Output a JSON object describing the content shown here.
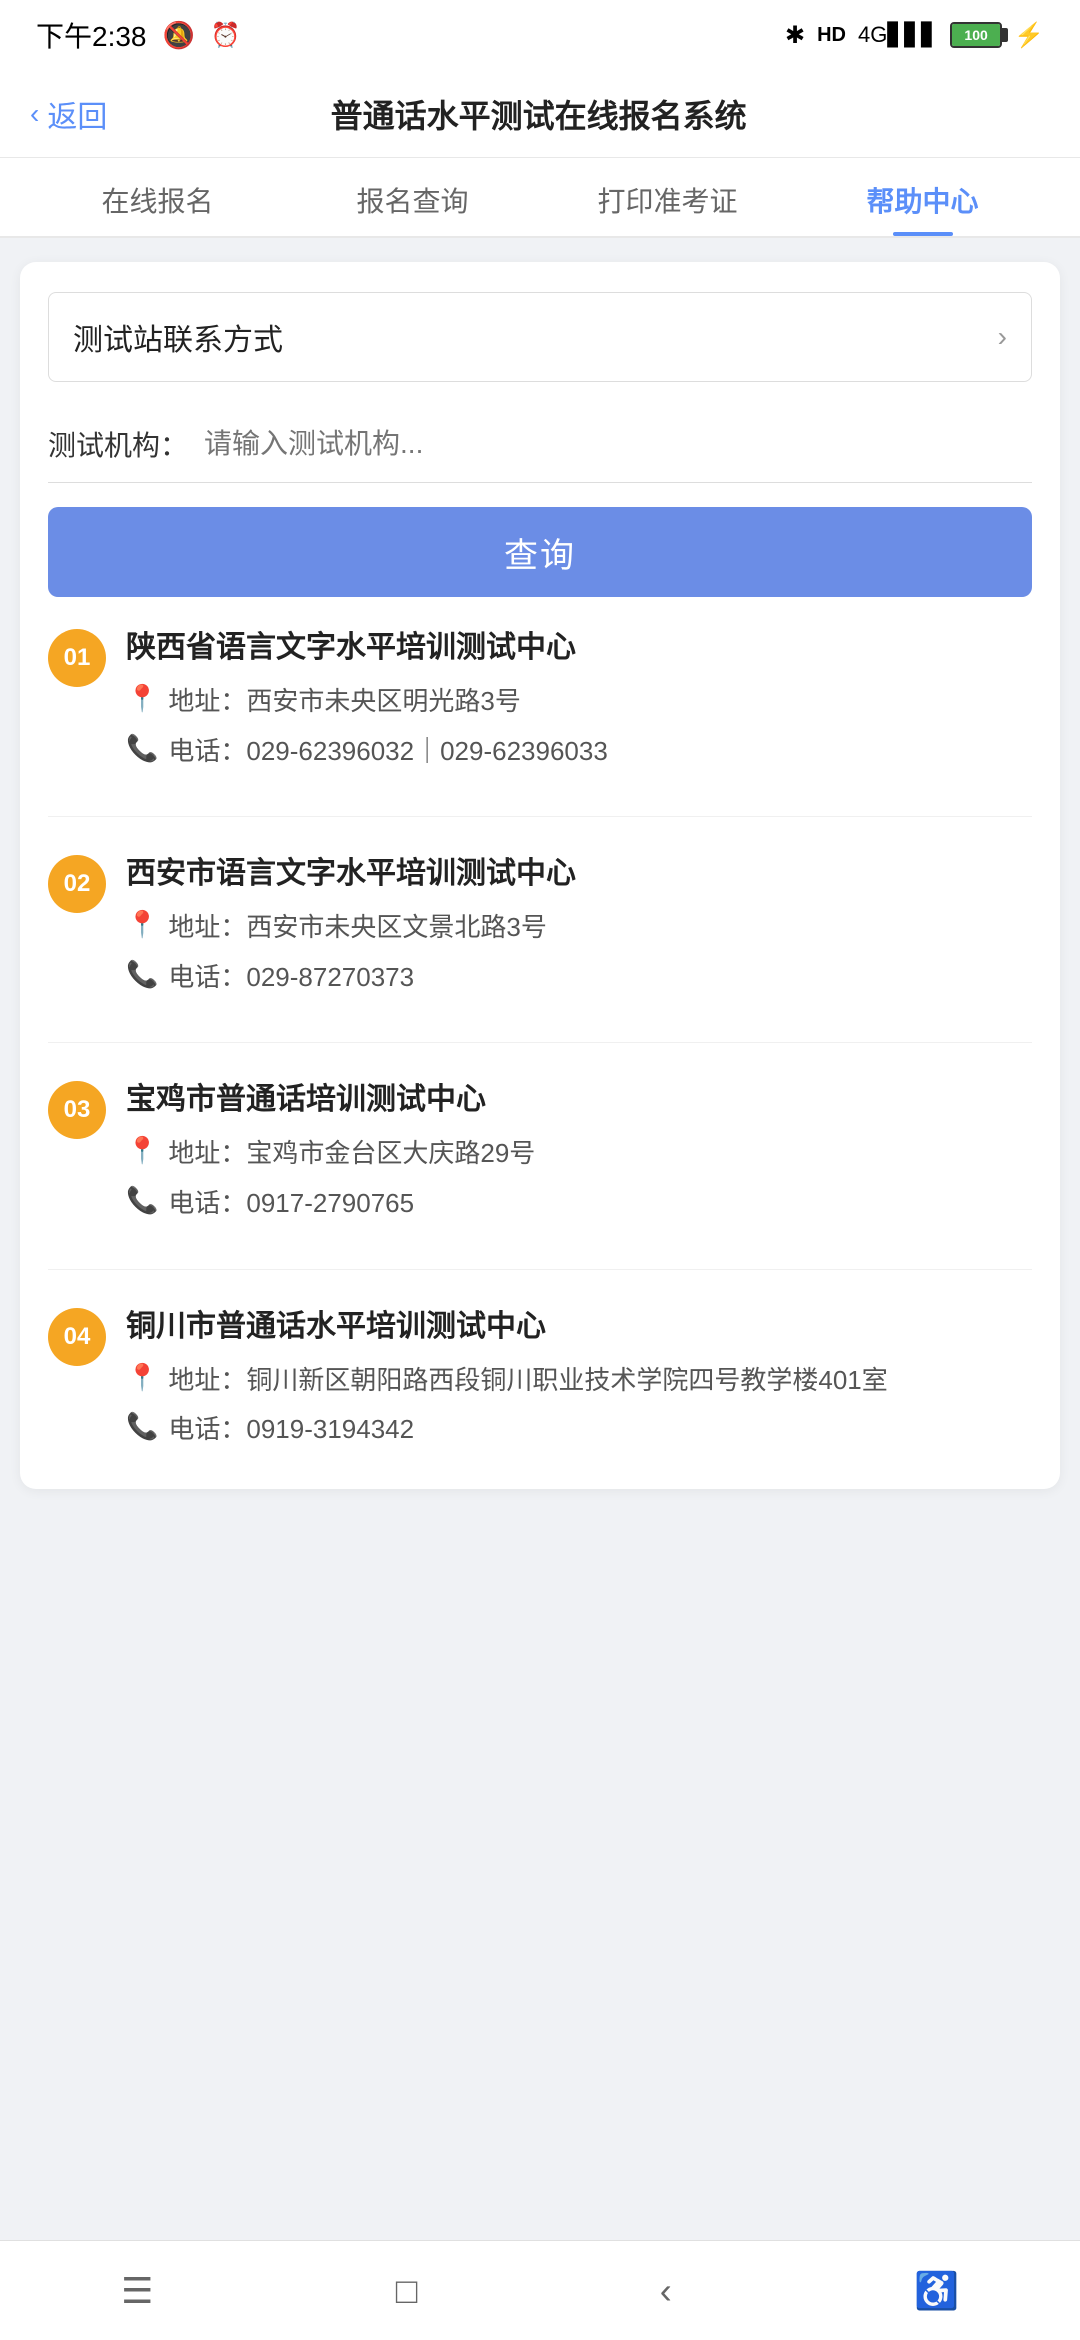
{
  "statusBar": {
    "time": "下午2:38",
    "bluetooth": "⊹",
    "hd": "HD",
    "signal": "4G",
    "battery": "100"
  },
  "nav": {
    "back": "返回",
    "title": "普通话水平测试在线报名系统"
  },
  "tabs": [
    {
      "id": "register",
      "label": "在线报名",
      "active": false
    },
    {
      "id": "query",
      "label": "报名查询",
      "active": false
    },
    {
      "id": "print",
      "label": "打印准考证",
      "active": false
    },
    {
      "id": "help",
      "label": "帮助中心",
      "active": true
    }
  ],
  "card": {
    "stationRow": {
      "label": "测试站联系方式",
      "chevron": "›"
    },
    "inputRow": {
      "label": "测试机构：",
      "placeholder": "请输入测试机构..."
    },
    "queryButton": "查询",
    "results": [
      {
        "badge": "01",
        "name": "陕西省语言文字水平培训测试中心",
        "address": "地址：西安市未央区明光路3号",
        "phone": "电话：029-62396032｜029-62396033"
      },
      {
        "badge": "02",
        "name": "西安市语言文字水平培训测试中心",
        "address": "地址：西安市未央区文景北路3号",
        "phone": "电话：029-87270373"
      },
      {
        "badge": "03",
        "name": "宝鸡市普通话培训测试中心",
        "address": "地址：宝鸡市金台区大庆路29号",
        "phone": "电话：0917-2790765"
      },
      {
        "badge": "04",
        "name": "铜川市普通话水平培训测试中心",
        "address": "地址：铜川新区朝阳路西段铜川职业技术学院四号教学楼401室",
        "phone": "电话：0919-3194342"
      }
    ]
  },
  "bottomNav": {
    "menu": "☰",
    "home": "□",
    "back": "‹",
    "accessibility": "♿"
  }
}
